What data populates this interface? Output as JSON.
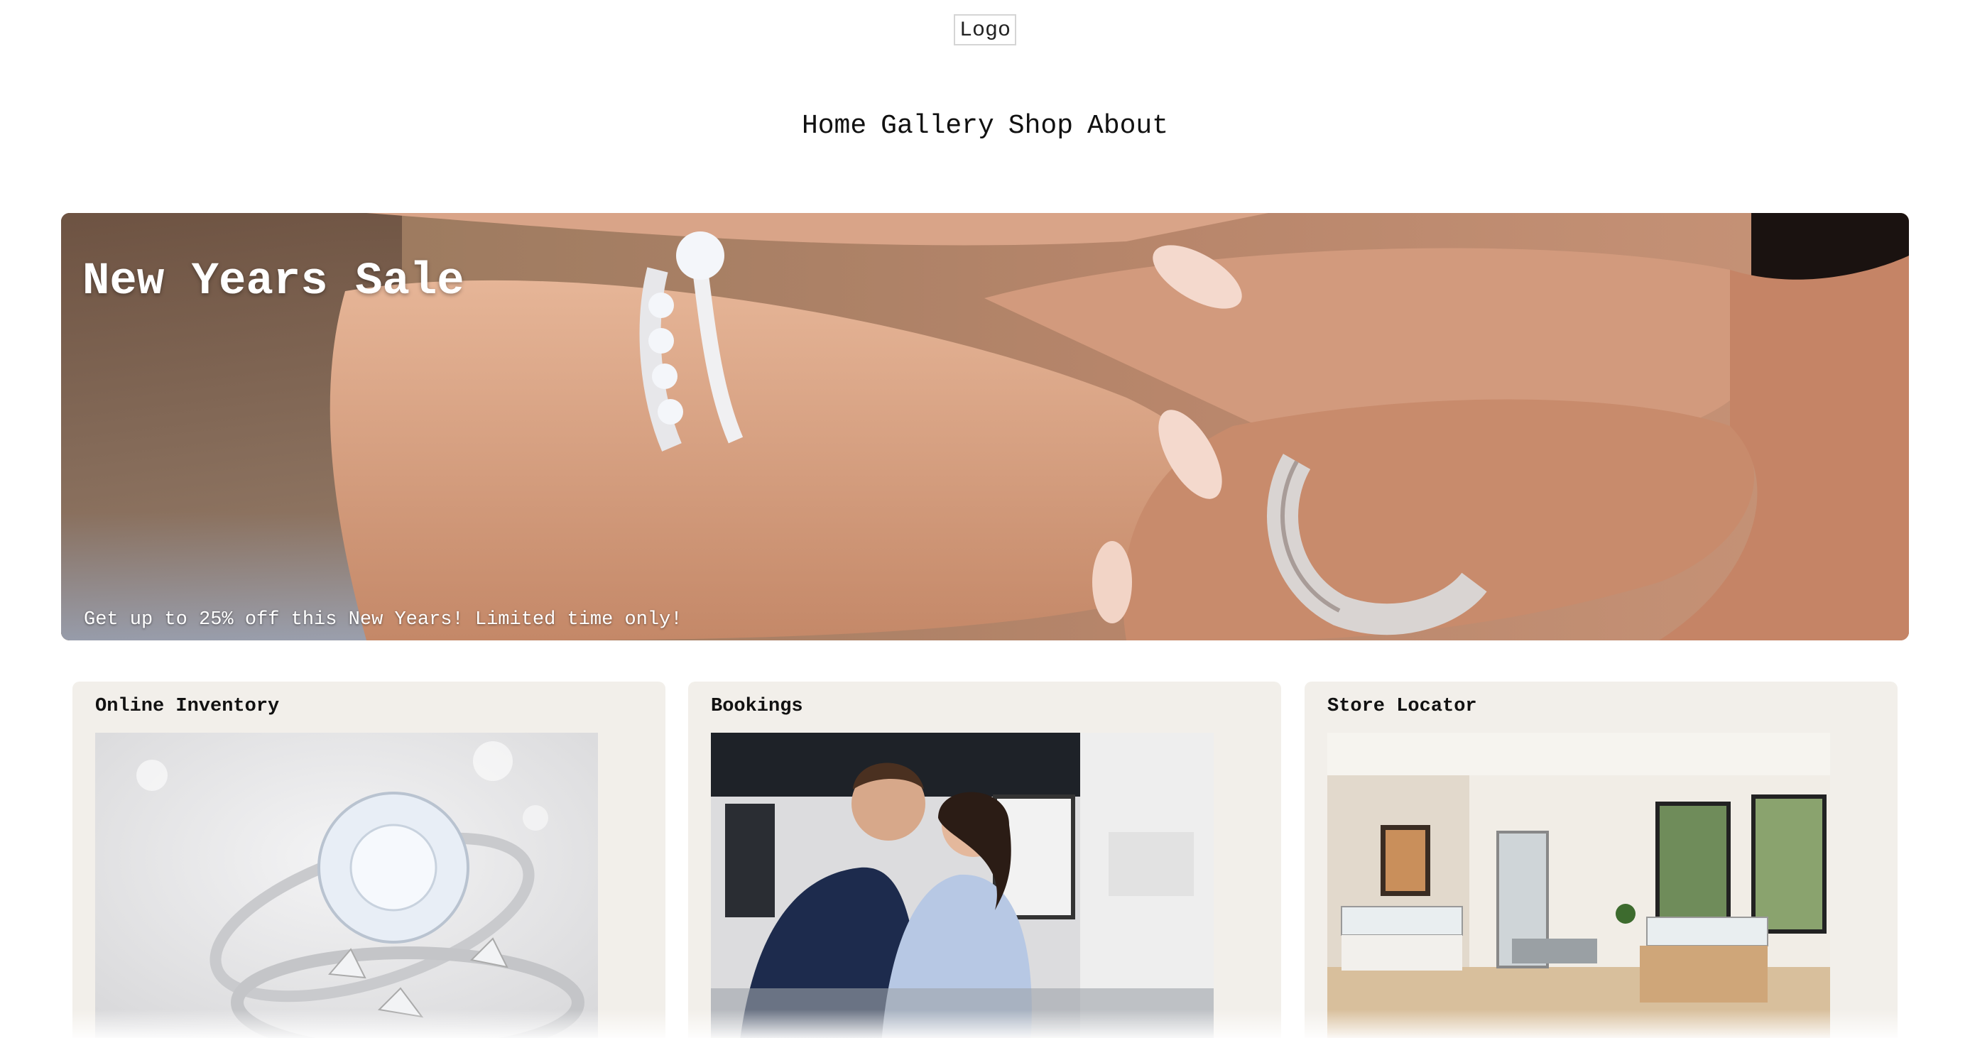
{
  "header": {
    "logo_label": "Logo"
  },
  "nav": {
    "items": [
      {
        "label": "Home"
      },
      {
        "label": "Gallery"
      },
      {
        "label": "Shop"
      },
      {
        "label": "About"
      }
    ]
  },
  "hero": {
    "title": "New Years Sale",
    "subtitle": "Get up to 25% off this New Years! Limited time only!",
    "image": "hands-with-rings-photo"
  },
  "cards": [
    {
      "title": "Online Inventory",
      "image": "diamond-ring-photo"
    },
    {
      "title": "Bookings",
      "image": "couple-at-jewelry-counter-photo"
    },
    {
      "title": "Store Locator",
      "image": "jewelry-store-interior-photo"
    }
  ],
  "colors": {
    "card_background": "#f2efea",
    "hero_text": "#ffffff"
  }
}
